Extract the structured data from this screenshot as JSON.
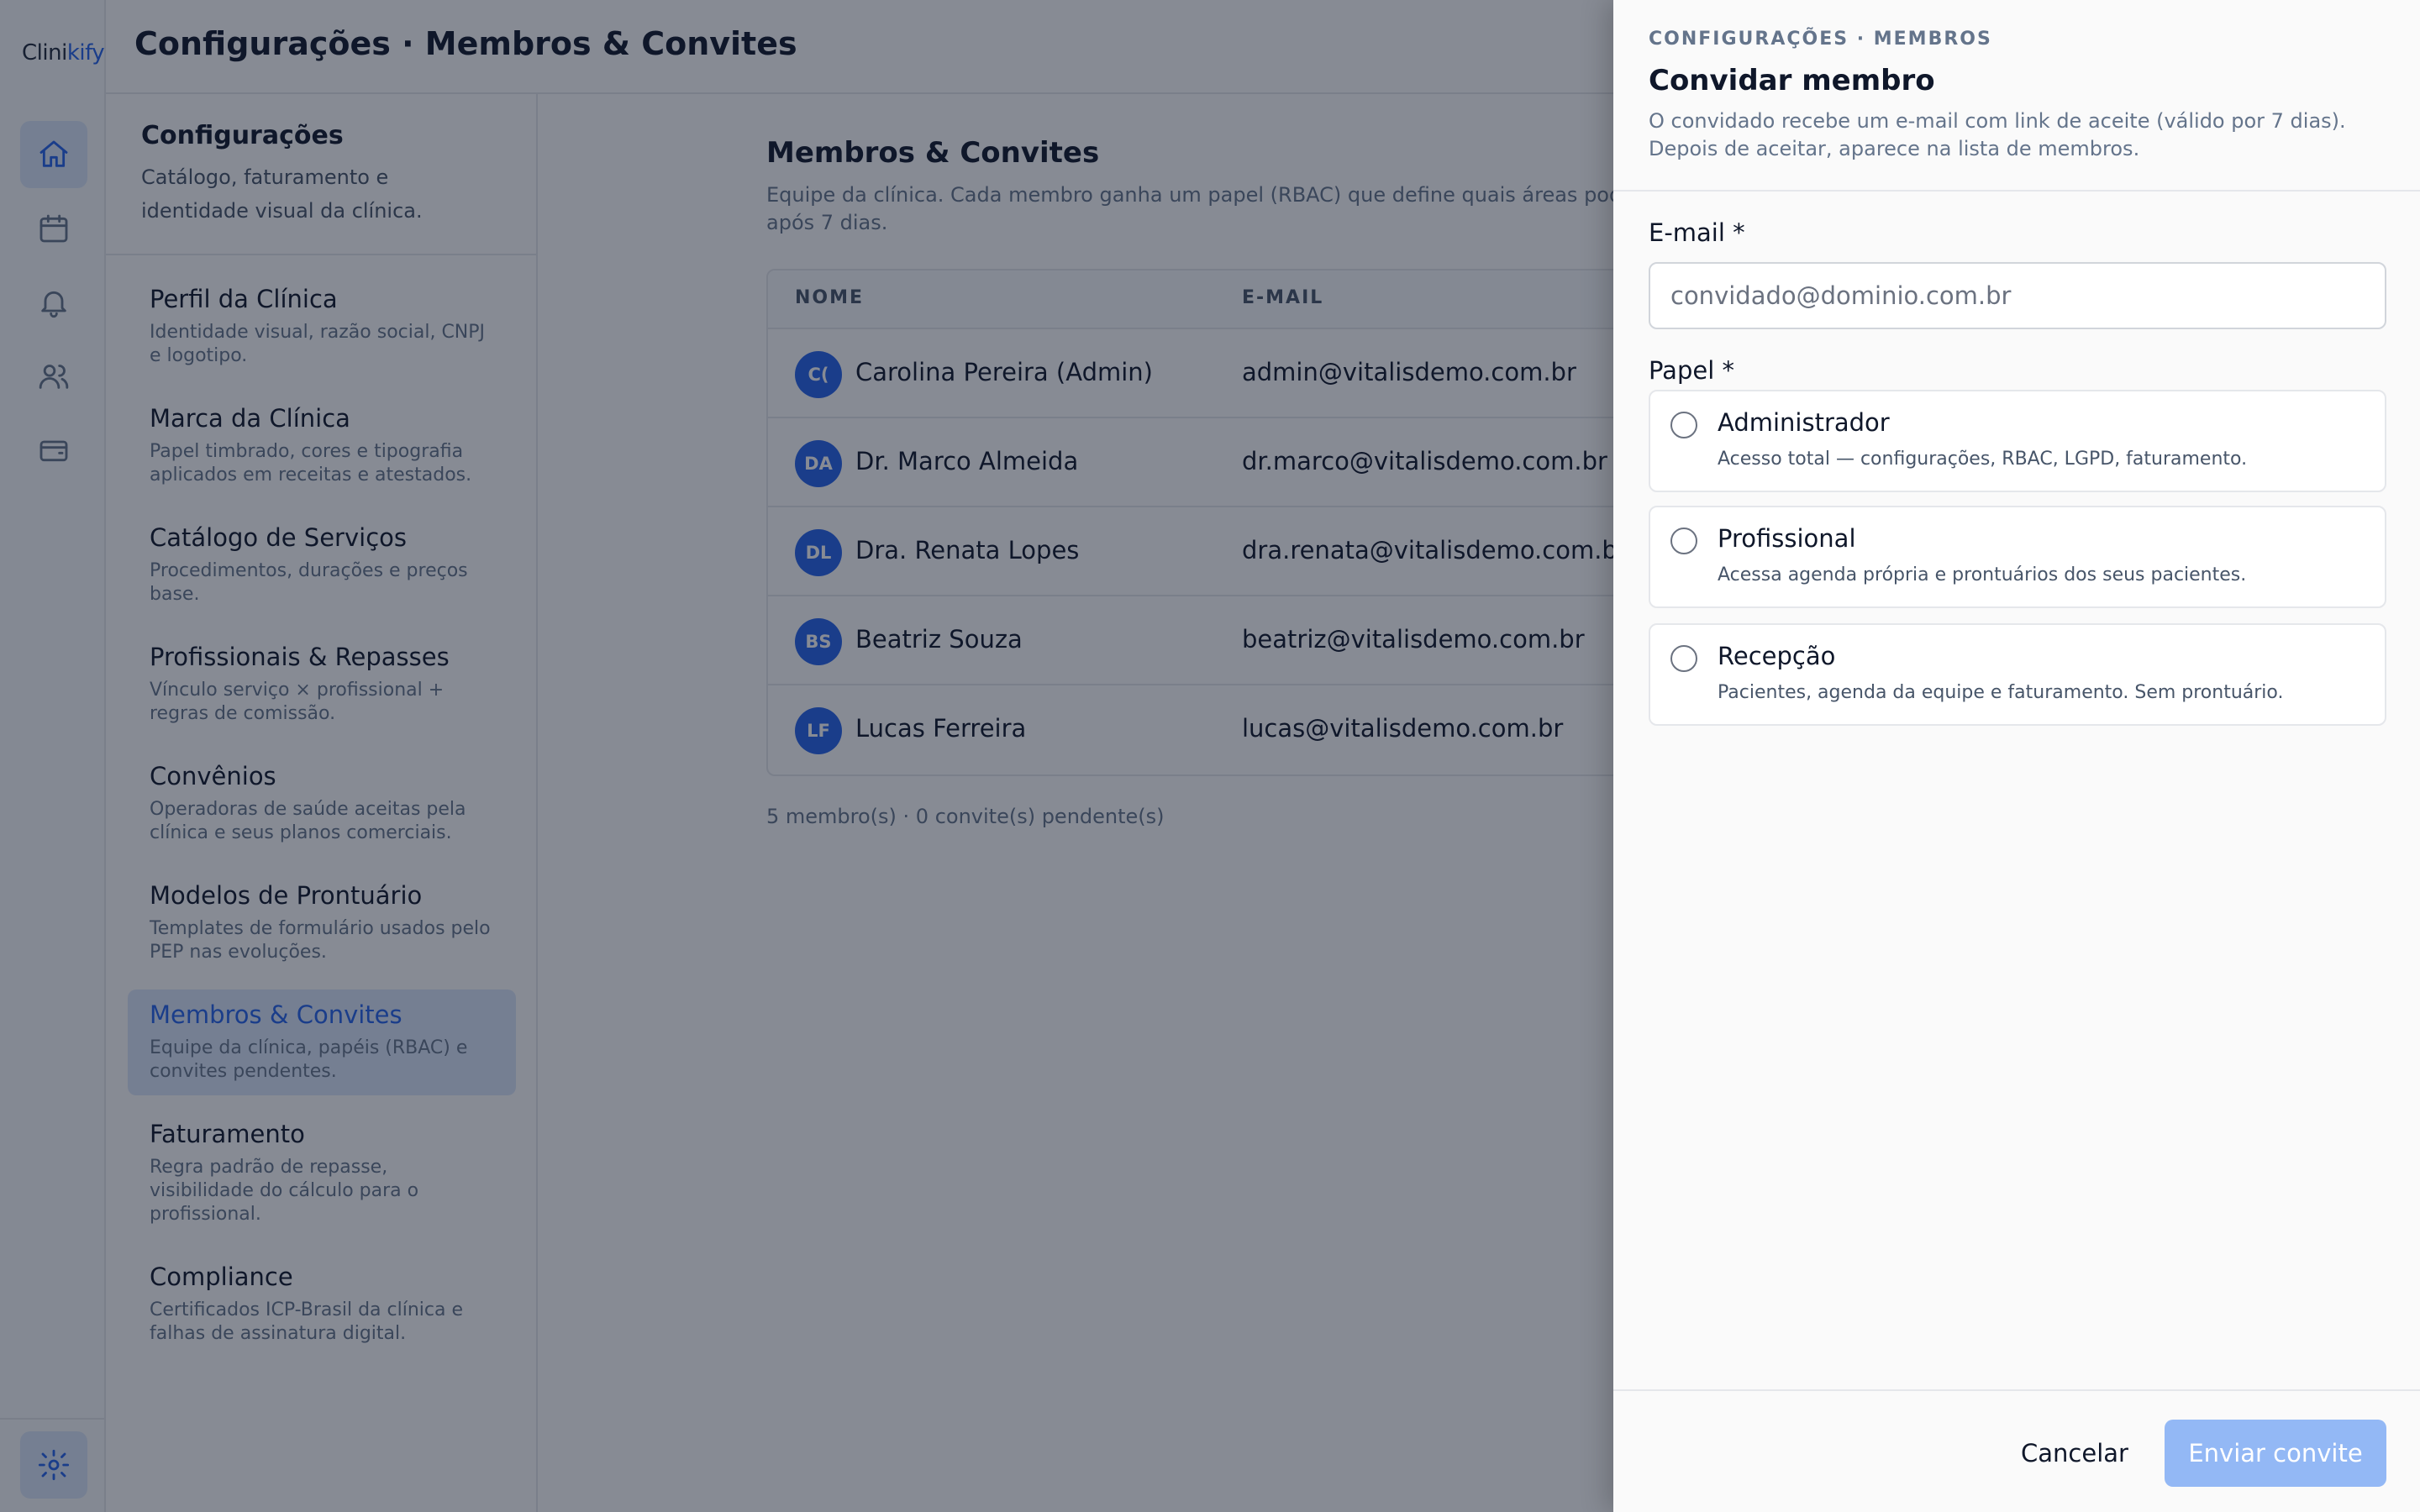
{
  "app": {
    "logo_prefix": "Clini",
    "logo_accent": "kify"
  },
  "rail": {
    "icons": [
      "home-icon",
      "calendar-icon",
      "bell-icon",
      "users-icon",
      "wallet-icon"
    ],
    "bottom_icon": "gear-icon",
    "active_color": "#2563eb"
  },
  "header": {
    "title": "Configurações · Membros & Convites"
  },
  "settings_nav": {
    "title": "Configurações",
    "description": "Catálogo, faturamento e identidade visual da clínica.",
    "items": [
      {
        "label": "Perfil da Clínica",
        "desc": "Identidade visual, razão social, CNPJ e logotipo."
      },
      {
        "label": "Marca da Clínica",
        "desc": "Papel timbrado, cores e tipografia aplicados em receitas e atestados."
      },
      {
        "label": "Catálogo de Serviços",
        "desc": "Procedimentos, durações e preços base."
      },
      {
        "label": "Profissionais & Repasses",
        "desc": "Vínculo serviço × profissional + regras de comissão."
      },
      {
        "label": "Convênios",
        "desc": "Operadoras de saúde aceitas pela clínica e seus planos comerciais."
      },
      {
        "label": "Modelos de Prontuário",
        "desc": "Templates de formulário usados pelo PEP nas evoluções."
      },
      {
        "label": "Membros & Convites",
        "desc": "Equipe da clínica, papéis (RBAC) e convites pendentes."
      },
      {
        "label": "Faturamento",
        "desc": "Regra padrão de repasse, visibilidade do cálculo para o profissional."
      },
      {
        "label": "Compliance",
        "desc": "Certificados ICP-Brasil da clínica e falhas de assinatura digital."
      }
    ]
  },
  "main": {
    "title": "Membros & Convites",
    "description": "Equipe da clínica. Cada membro ganha um papel (RBAC) que define quais áreas pode acessar. Convites expiram após 7 dias.",
    "columns": [
      "NOME",
      "E-MAIL"
    ],
    "members": [
      {
        "initials": "C(",
        "name": "Carolina Pereira (Admin)",
        "email": "admin@vitalisdemo.com.br"
      },
      {
        "initials": "DA",
        "name": "Dr. Marco Almeida",
        "email": "dr.marco@vitalisdemo.com.br"
      },
      {
        "initials": "DL",
        "name": "Dra. Renata Lopes",
        "email": "dra.renata@vitalisdemo.com.br"
      },
      {
        "initials": "BS",
        "name": "Beatriz Souza",
        "email": "beatriz@vitalisdemo.com.br"
      },
      {
        "initials": "LF",
        "name": "Lucas Ferreira",
        "email": "lucas@vitalisdemo.com.br"
      }
    ],
    "summary": "5 membro(s) · 0 convite(s) pendente(s)"
  },
  "drawer": {
    "breadcrumb": "CONFIGURAÇÕES · MEMBROS",
    "title": "Convidar membro",
    "description": "O convidado recebe um e-mail com link de aceite (válido por 7 dias). Depois de aceitar, aparece na lista de membros.",
    "email_label": "E-mail *",
    "email_placeholder": "convidado@dominio.com.br",
    "email_value": "",
    "role_label": "Papel *",
    "roles": [
      {
        "title": "Administrador",
        "desc": "Acesso total — configurações, RBAC, LGPD, faturamento."
      },
      {
        "title": "Profissional",
        "desc": "Acessa agenda própria e prontuários dos seus pacientes."
      },
      {
        "title": "Recepção",
        "desc": "Pacientes, agenda da equipe e faturamento. Sem prontuário."
      }
    ],
    "cancel_label": "Cancelar",
    "submit_label": "Enviar convite",
    "submit_color": "#93b8f5"
  }
}
